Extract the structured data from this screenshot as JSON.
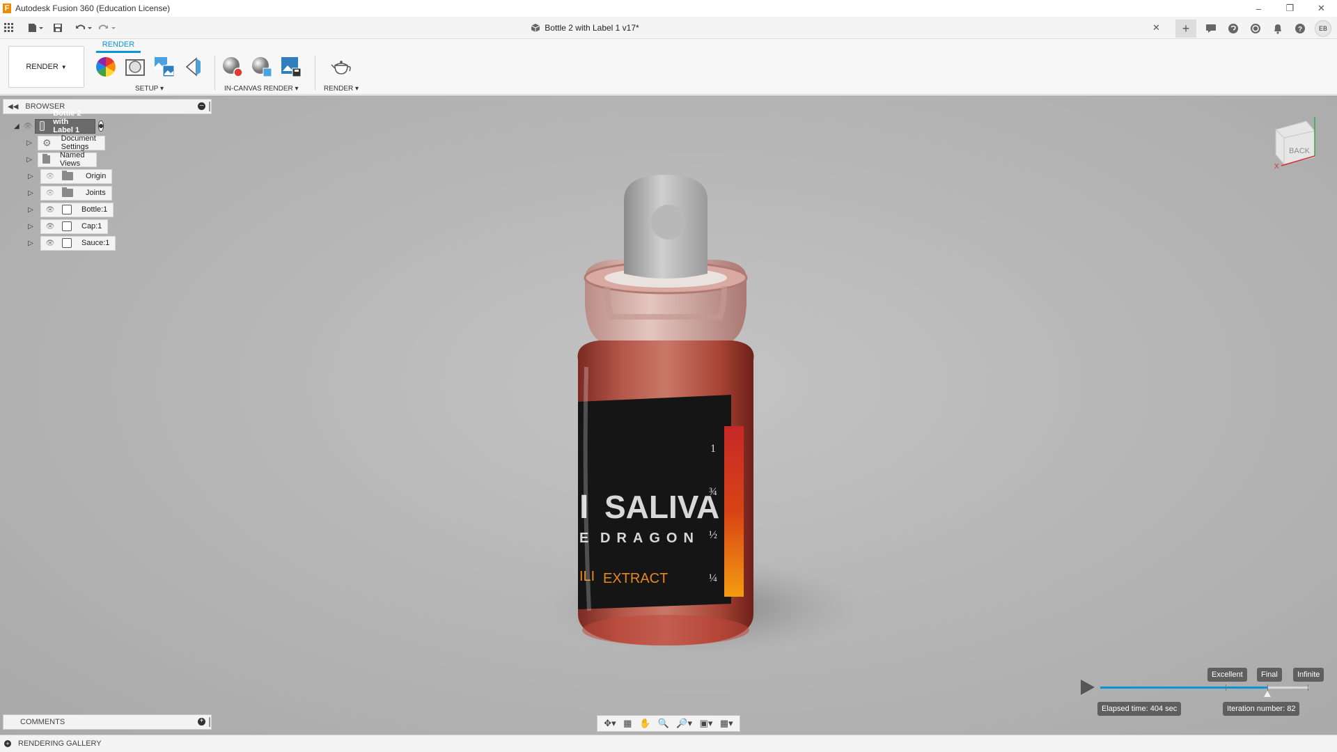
{
  "app": {
    "title": "Autodesk Fusion 360 (Education License)",
    "logo_letter": "F"
  },
  "document": {
    "tab_title": "Bottle 2 with Label 1 v17*"
  },
  "user": {
    "initials": "EB"
  },
  "ribbon": {
    "workspace_label": "RENDER",
    "active_tab": "RENDER",
    "groups": {
      "setup": "SETUP",
      "in_canvas": "IN-CANVAS RENDER",
      "render": "RENDER"
    }
  },
  "browser": {
    "title": "BROWSER",
    "root": "Bottle 2 with Label 1 v17",
    "items": [
      {
        "label": "Document Settings",
        "icon": "gear-icon"
      },
      {
        "label": "Named Views",
        "icon": "folder-icon"
      },
      {
        "label": "Origin",
        "icon": "folder-icon"
      },
      {
        "label": "Joints",
        "icon": "folder-icon"
      },
      {
        "label": "Bottle:1",
        "icon": "component-icon"
      },
      {
        "label": "Cap:1",
        "icon": "component-icon"
      },
      {
        "label": "Sauce:1",
        "icon": "component-icon"
      }
    ]
  },
  "scene": {
    "label_title": "SALIVA",
    "label_title_prefix": "I",
    "label_subtitle": "DRAGON",
    "label_subtitle_prefix": "E",
    "label_extract": "EXTRACT",
    "label_chili": "ILI",
    "scale_marks": [
      "1",
      "¾",
      "½",
      "¼"
    ]
  },
  "viewcube": {
    "face": "BACK",
    "axis_x": "X"
  },
  "comments": {
    "title": "COMMENTS"
  },
  "render_gallery": {
    "title": "RENDERING GALLERY"
  },
  "render_quality": {
    "levels": [
      "Excellent",
      "Final",
      "Infinite"
    ],
    "progress": 0.8,
    "elapsed": "Elapsed time: 404 sec",
    "iteration": "Iteration number: 82"
  },
  "colors": {
    "accent": "#0696d7",
    "liquid": "#b34b3a",
    "label": "#141414"
  }
}
